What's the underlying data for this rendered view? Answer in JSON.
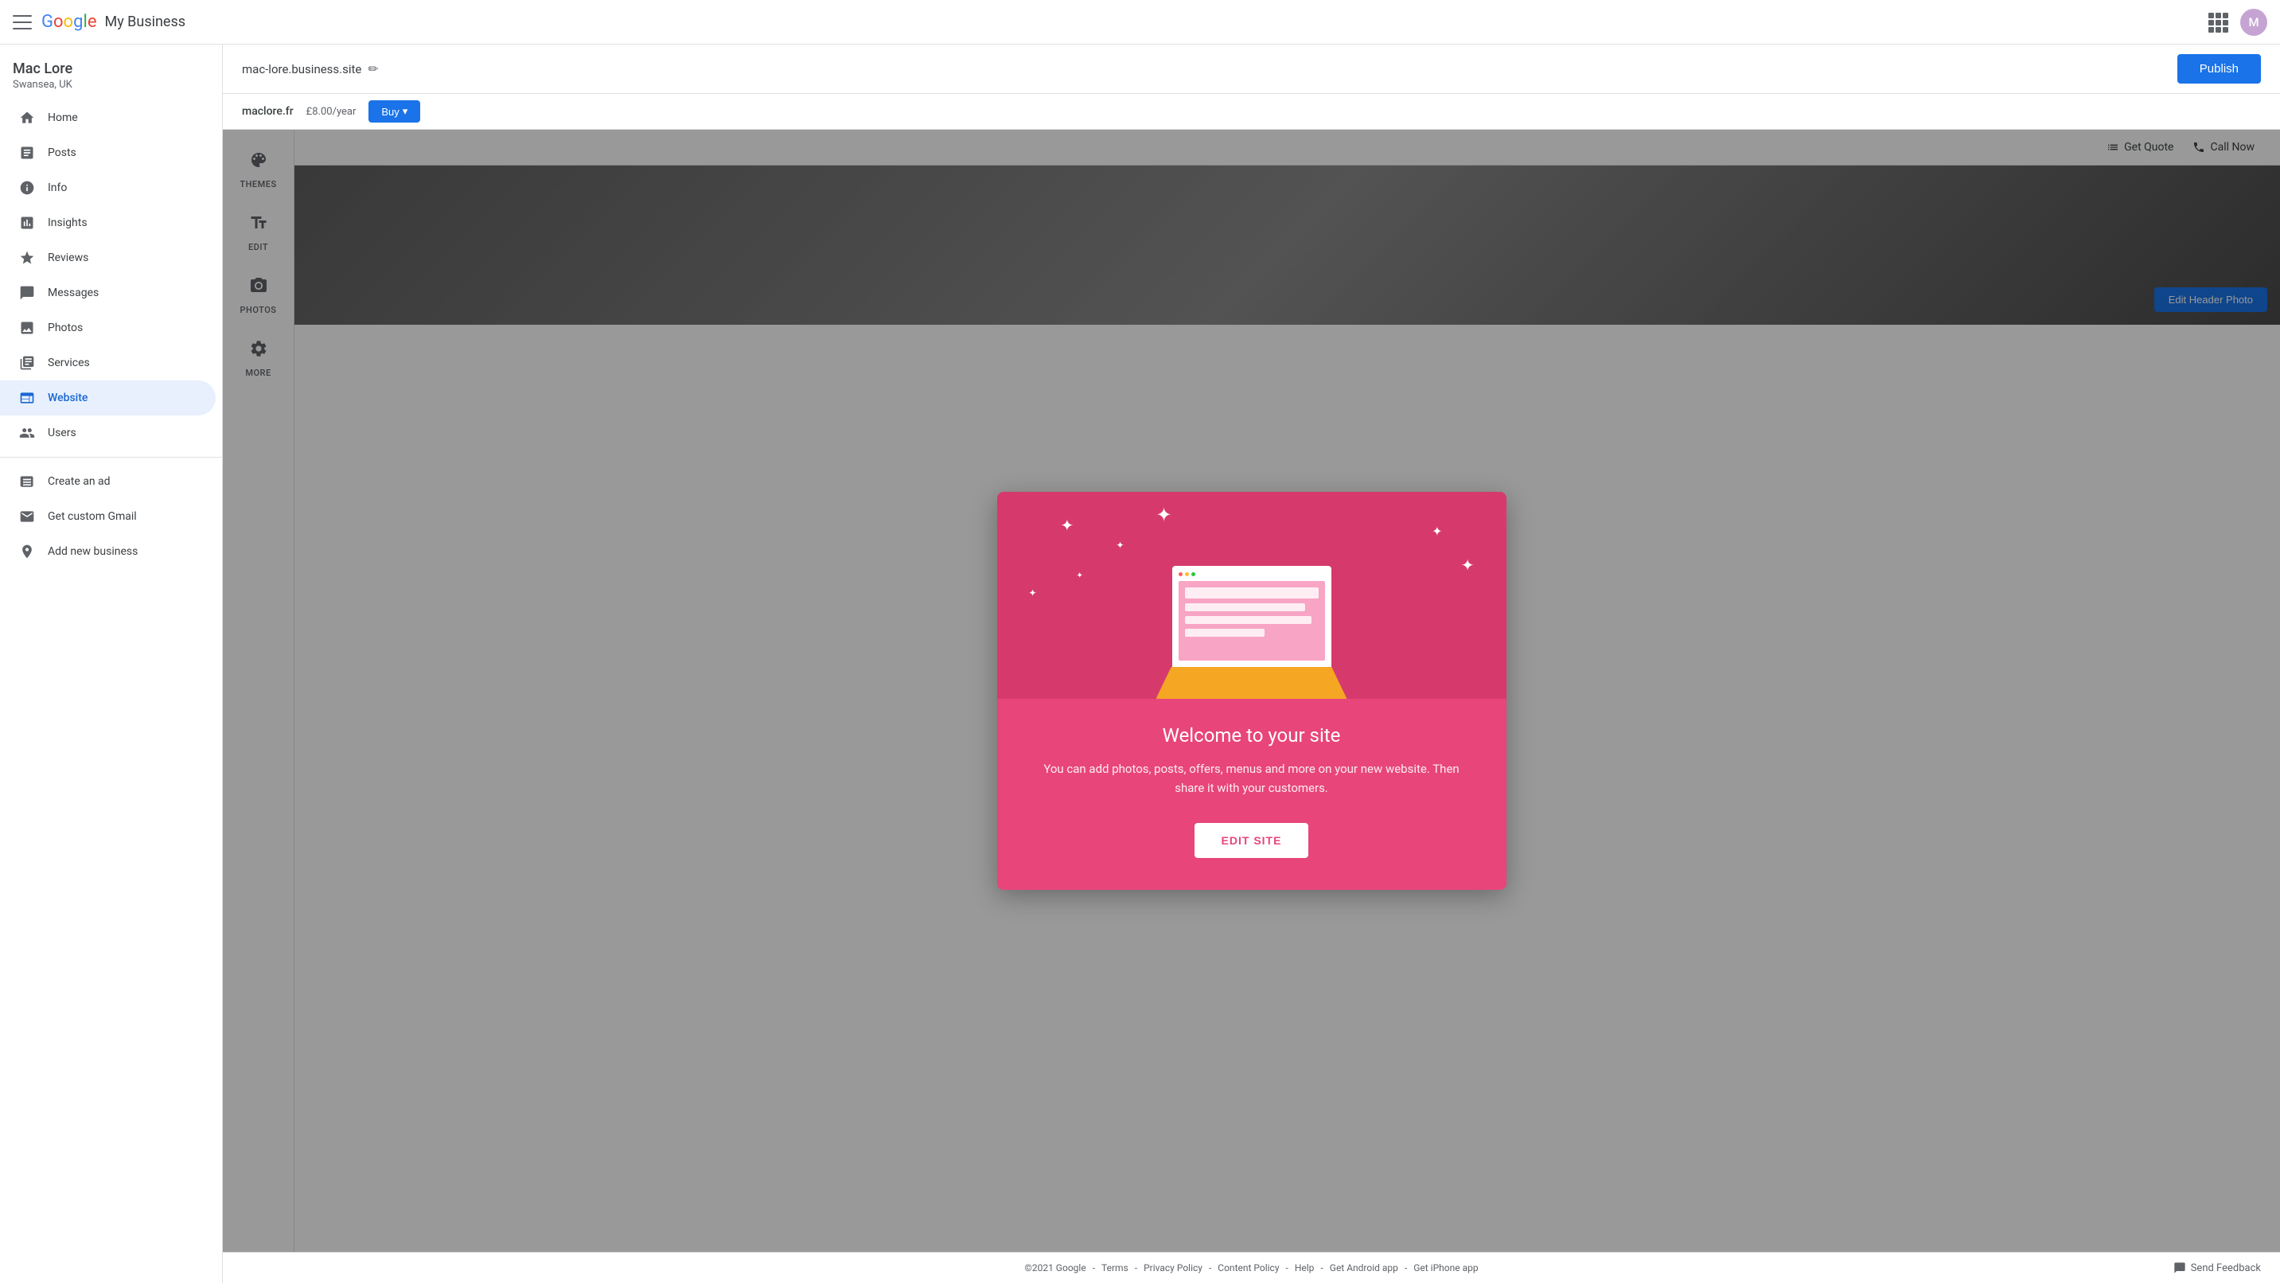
{
  "topBar": {
    "appName": "My Business",
    "avatarInitial": "M"
  },
  "sidebar": {
    "userName": "Mac Lore",
    "userLocation": "Swansea, UK",
    "navItems": [
      {
        "id": "home",
        "label": "Home",
        "icon": "home"
      },
      {
        "id": "posts",
        "label": "Posts",
        "icon": "posts"
      },
      {
        "id": "info",
        "label": "Info",
        "icon": "info"
      },
      {
        "id": "insights",
        "label": "Insights",
        "icon": "insights"
      },
      {
        "id": "reviews",
        "label": "Reviews",
        "icon": "reviews"
      },
      {
        "id": "messages",
        "label": "Messages",
        "icon": "messages"
      },
      {
        "id": "photos",
        "label": "Photos",
        "icon": "photos"
      },
      {
        "id": "services",
        "label": "Services",
        "icon": "services"
      },
      {
        "id": "website",
        "label": "Website",
        "icon": "website",
        "active": true
      },
      {
        "id": "users",
        "label": "Users",
        "icon": "users"
      }
    ],
    "bottomNavItems": [
      {
        "id": "create-ad",
        "label": "Create an ad",
        "icon": "create-ad"
      },
      {
        "id": "custom-gmail",
        "label": "Get custom Gmail",
        "icon": "gmail"
      },
      {
        "id": "add-business",
        "label": "Add new business",
        "icon": "add-business"
      }
    ]
  },
  "contentHeader": {
    "url": "mac-lore.business.site",
    "publishLabel": "Publish"
  },
  "domainBar": {
    "domainName": "maclore.fr",
    "price": "£8.00",
    "priceUnit": "/year",
    "buyLabel": "Buy"
  },
  "tools": [
    {
      "id": "themes",
      "label": "THEMES",
      "icon": "palette"
    },
    {
      "id": "edit",
      "label": "EDIT",
      "icon": "text"
    },
    {
      "id": "photos",
      "label": "PHOTOS",
      "icon": "camera"
    },
    {
      "id": "more",
      "label": "MORE",
      "icon": "gear"
    }
  ],
  "sitePreview": {
    "navItems": [
      {
        "label": "Get Quote",
        "icon": "list"
      },
      {
        "label": "Call Now",
        "icon": "phone"
      }
    ],
    "editHeaderPhotoLabel": "Edit Header Photo"
  },
  "modal": {
    "title": "Welcome to your site",
    "description": "You can add photos, posts, offers, menus and more on your new website. Then share it with your customers.",
    "buttonLabel": "EDIT SITE"
  },
  "footer": {
    "copyright": "©2021 Google",
    "links": [
      "Terms",
      "Privacy Policy",
      "Content Policy",
      "Help",
      "Get Android app",
      "Get iPhone app"
    ],
    "sendFeedback": "Send Feedback",
    "separator": "-"
  }
}
